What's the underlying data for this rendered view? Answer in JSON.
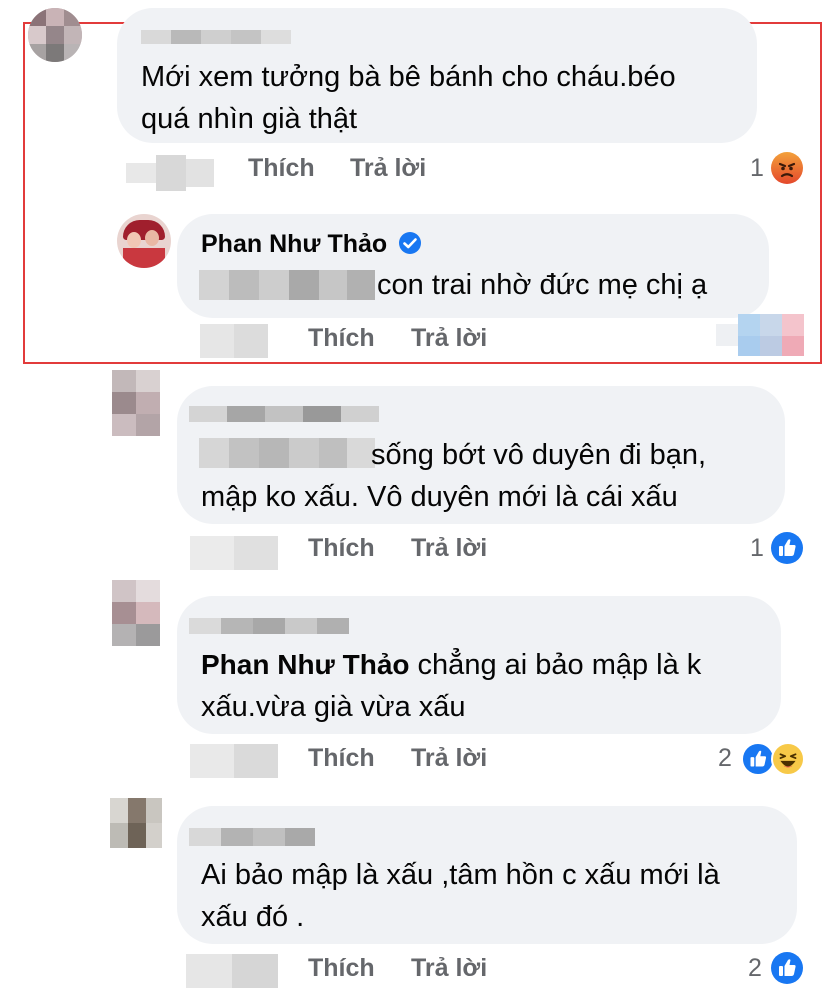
{
  "comments": [
    {
      "id": "c1",
      "text": "Mới xem tưởng bà bê bánh cho cháu.béo\nquá nhìn già thật",
      "like_label": "Thích",
      "reply_label": "Trả lời",
      "reaction_count": "1",
      "reactions": [
        "angry-icon"
      ]
    },
    {
      "id": "c2",
      "author": "Phan Như Thảo",
      "verified": true,
      "text": "con trai nhờ đức mẹ chị ạ",
      "like_label": "Thích",
      "reply_label": "Trả lời"
    },
    {
      "id": "c3",
      "text": "sống bớt vô duyên đi bạn,\nmập ko xấu. Vô duyên mới là cái xấu",
      "like_label": "Thích",
      "reply_label": "Trả lời",
      "reaction_count": "1",
      "reactions": [
        "like-icon"
      ]
    },
    {
      "id": "c4",
      "mention": "Phan Như Thảo",
      "text_after_mention": " chẳng ai bảo mập là k",
      "text_line2": "xấu.vừa già vừa xấu",
      "like_label": "Thích",
      "reply_label": "Trả lời",
      "reaction_count": "2",
      "reactions": [
        "like-icon",
        "haha-icon"
      ]
    },
    {
      "id": "c5",
      "text": "Ai bảo mập là xấu ,tâm hồn c xấu mới là\nxấu đó .",
      "like_label": "Thích",
      "reply_label": "Trả lời",
      "reaction_count": "2",
      "reactions": [
        "like-icon"
      ]
    }
  ],
  "colors": {
    "bubble": "#f0f2f5",
    "meta_text": "#65676b",
    "highlight_border": "#e23b3b",
    "like_blue": "#1877f2",
    "angry_orange": "#f0602a",
    "haha_yellow": "#f7c948"
  }
}
